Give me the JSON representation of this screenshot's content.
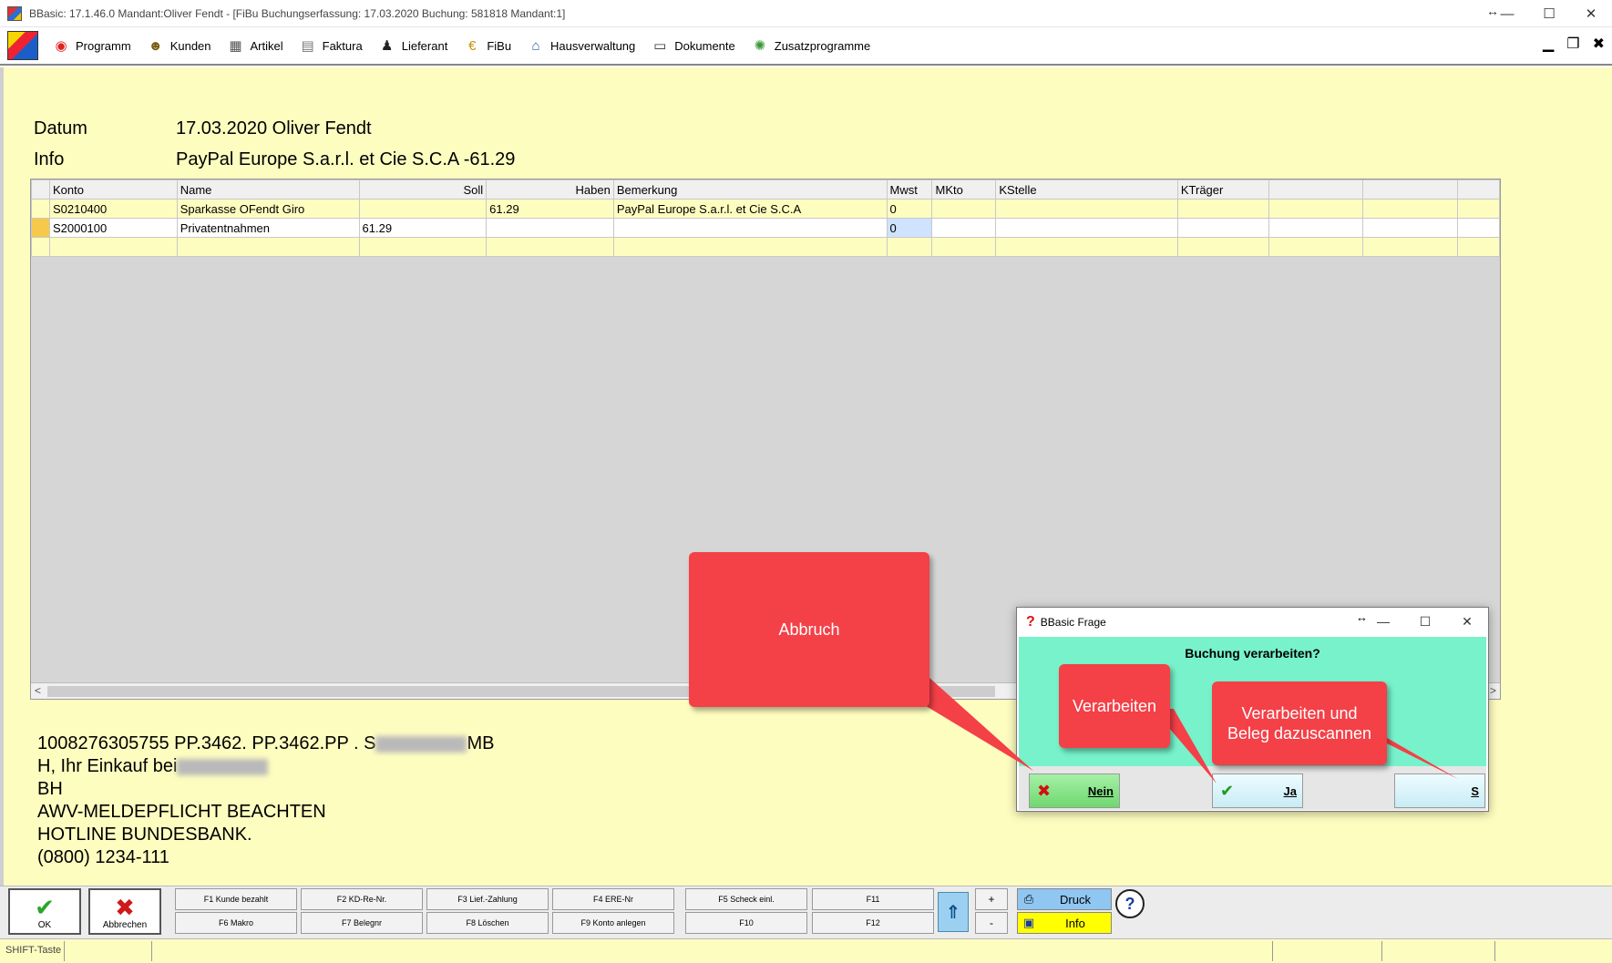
{
  "window": {
    "title": "BBasic: 17.1.46.0 Mandant:Oliver Fendt  - [FiBu Buchungserfassung: 17.03.2020  Buchung: 581818  Mandant:1]",
    "controls": {
      "resize": "↔",
      "minimize": "—",
      "maximize": "☐",
      "close": "✕"
    }
  },
  "menubar": {
    "items": [
      {
        "label": "Programm",
        "icon": "programm-icon"
      },
      {
        "label": "Kunden",
        "icon": "kunden-icon"
      },
      {
        "label": "Artikel",
        "icon": "artikel-icon"
      },
      {
        "label": "Faktura",
        "icon": "faktura-icon"
      },
      {
        "label": "Lieferant",
        "icon": "lieferant-icon"
      },
      {
        "label": "FiBu",
        "icon": "fibu-icon"
      },
      {
        "label": "Hausverwaltung",
        "icon": "hausverwaltung-icon"
      },
      {
        "label": "Dokumente",
        "icon": "dokumente-icon"
      },
      {
        "label": "Zusatzprogramme",
        "icon": "zusatzprogramme-icon"
      }
    ],
    "mdi": {
      "minimize": "▁",
      "restore": "❐",
      "close": "✖"
    }
  },
  "header": {
    "datum_label": "Datum",
    "datum_value": "17.03.2020  Oliver Fendt",
    "info_label": "Info",
    "info_value": "PayPal Europe S.a.r.l. et Cie S.C.A -61.29"
  },
  "grid": {
    "columns": [
      "",
      "Konto",
      "Name",
      "Soll",
      "Haben",
      "Bemerkung",
      "Mwst",
      "MKto",
      "KStelle",
      "KTräger",
      "",
      "",
      ""
    ],
    "rows": [
      [
        "",
        "S0210400",
        "Sparkasse OFendt Giro",
        "",
        "61.29",
        "PayPal Europe S.a.r.l. et Cie S.C.A",
        "0",
        "",
        "",
        "",
        "",
        "",
        ""
      ],
      [
        "",
        "S2000100",
        "Privatentnahmen",
        "61.29",
        "",
        "",
        "0",
        "",
        "",
        "",
        "",
        "",
        ""
      ],
      [
        "",
        "",
        "",
        "",
        "",
        "",
        "",
        "",
        "",
        "",
        "",
        "",
        ""
      ]
    ],
    "scroll_left": "<",
    "scroll_right": ">"
  },
  "notes": {
    "line1_a": "1008276305755 PP.3462. PP.3462.PP . S",
    "line1_b": "MB",
    "line2": "H, Ihr Einkauf bei",
    "line3": "BH",
    "line4": "AWV-MELDEPFLICHT BEACHTEN",
    "line5": "HOTLINE BUNDESBANK.",
    "line6": "(0800) 1234-111"
  },
  "callouts": {
    "abbruch": "Abbruch",
    "verarbeiten": "Verarbeiten",
    "verarbeiten_scan_1": "Verarbeiten und",
    "verarbeiten_scan_2": "Beleg dazuscannen"
  },
  "dialog": {
    "title": "BBasic Frage",
    "question": "Buchung verarbeiten?",
    "buttons": {
      "nein": "Nein",
      "ja": "Ja",
      "scan": "S"
    }
  },
  "toolbar": {
    "ok": "OK",
    "abbrechen": "Abbrechen",
    "fkeys_top": [
      "F1 Kunde bezahlt",
      "F2 KD-Re-Nr.",
      "F3 Lief.-Zahlung",
      "F4 ERE-Nr",
      "F5 Scheck einl.",
      "F11"
    ],
    "fkeys_bottom": [
      "F6 Makro",
      "F7 Belegnr",
      "F8 Löschen",
      "F9 Konto anlegen",
      "F10",
      "F12"
    ],
    "plus": "+",
    "minus": "-",
    "druck": "Druck",
    "info": "Info",
    "help": "?"
  },
  "statusbar": {
    "shift": "SHIFT-Taste"
  },
  "colors": {
    "background": "#fefdc0",
    "dialog_body": "#77f2cb",
    "callout": "#f44047"
  }
}
